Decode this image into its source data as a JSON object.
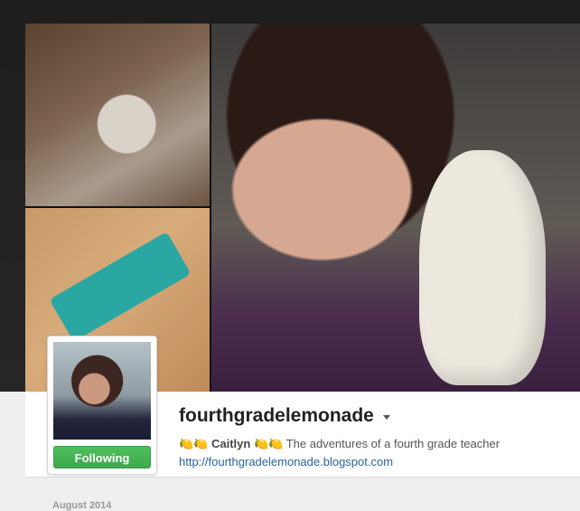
{
  "profile": {
    "username": "fourthgradelemonade",
    "name_prefix_glyphs": "🍋🍋",
    "name": "Caitlyn",
    "name_suffix_glyphs": "🍋🍋",
    "bio": "The adventures of a fourth grade teacher",
    "website": "http://fourthgradelemonade.blogspot.com"
  },
  "follow_button": {
    "label": "Following",
    "color": "#44b154"
  },
  "feed": {
    "month_label": "August 2014"
  },
  "colors": {
    "top_background": "#222222",
    "link": "#2a6496",
    "panel": "#ffffff",
    "page": "#efefef"
  }
}
